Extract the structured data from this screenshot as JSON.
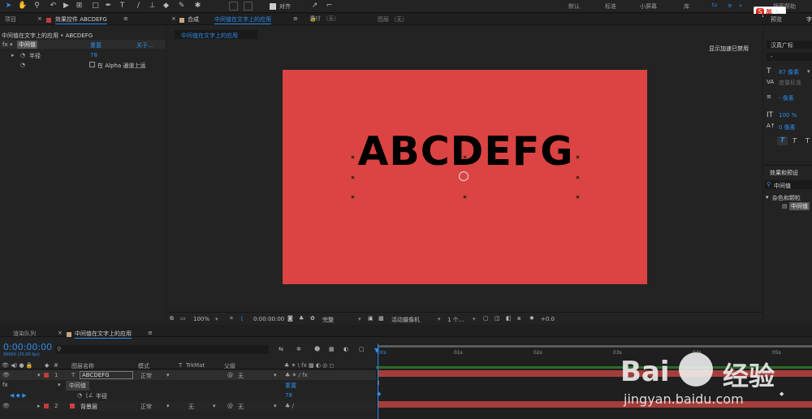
{
  "toolbar": {
    "snap_label": "对齐",
    "workspaces": [
      "默认",
      "标准",
      "小屏幕",
      "库"
    ],
    "search_help": "搜索帮助"
  },
  "ime": {
    "label": "英"
  },
  "project_panel": {
    "tab": "项目"
  },
  "effect_controls": {
    "tab_label": "效果控件 ABCDEFG",
    "breadcrumb": "中间值在文字上的应用 • ABCDEFG",
    "effect_name": "中间值",
    "reset": "重置",
    "about": "关于...",
    "radius_label": "半径",
    "radius_value": "78",
    "alpha_option": "在 Alpha 通道上运"
  },
  "composition": {
    "tab_prefix": "合成",
    "tab_name": "中间值在文字上的应用",
    "breadcrumb_tab": "中间值在文字上的应用",
    "footage_tab": "素材 （无）",
    "layer_tab": "图层 （无）",
    "accel_notice": "显示加速已禁用",
    "canvas_text": "ABCDEFG",
    "bg_color": "#db4443"
  },
  "viewer_footer": {
    "zoom": "100%",
    "timecode": "0:00:00:00",
    "resolution": "完整",
    "camera": "活动摄像机",
    "views": "1 个...",
    "exposure": "+0.0"
  },
  "right_panel": {
    "tabs": [
      "预览",
      "字"
    ],
    "font_name": "汉真广标",
    "font_style": "-",
    "font_size": "87 像素",
    "leading": "度量标准",
    "stroke": "- 像素",
    "vscale": "100 %",
    "baseline": "0 像素",
    "styles": [
      "T",
      "T",
      "T"
    ],
    "effects_tab": "效果和预设",
    "search_value": "中间值",
    "category": "杂色和颗粒",
    "result": "中间值"
  },
  "timeline": {
    "render_tab": "渲染队列",
    "comp_tab": "中间值在文字上的应用",
    "timecode": "0:00:00:00",
    "fps": "00000 (25.00 fps)",
    "search_placeholder": "",
    "columns": {
      "num": "#",
      "layer_name": "图层名称",
      "mode": "模式",
      "t": "T",
      "trkmat": "TrkMat",
      "parent": "父级"
    },
    "layer1": {
      "num": "1",
      "type": "T",
      "name": "ABCDEFG",
      "mode": "正常",
      "parent": "无"
    },
    "effect_row": {
      "name": "中间值",
      "reset": "重置"
    },
    "radius_row": {
      "name": "半径",
      "value": "78"
    },
    "layer2": {
      "num": "2",
      "name": "背景层",
      "mode": "正常",
      "trkmat": "无",
      "parent": "无"
    },
    "ruler": [
      "00s",
      "01s",
      "02s",
      "03s",
      "04s",
      "05s"
    ]
  },
  "watermark": {
    "brand": "Bai",
    "brand2": "经验",
    "url": "jingyan.baidu.com"
  },
  "colors": {
    "accent": "#2d8ceb",
    "layer_red": "#a43e3c",
    "label_red": "#c33b3b"
  }
}
